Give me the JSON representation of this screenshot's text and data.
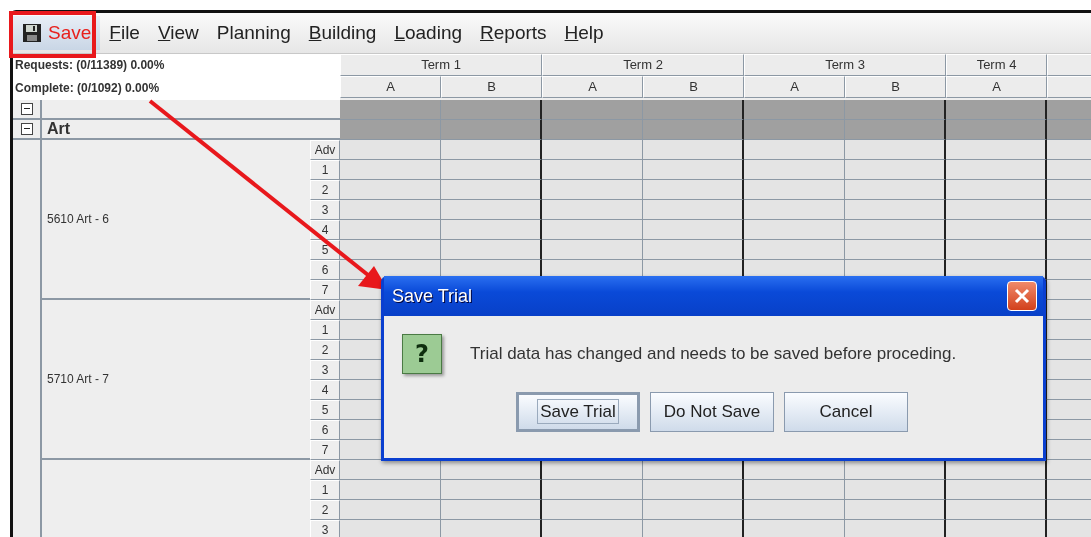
{
  "menu": {
    "items": [
      {
        "label": "Save",
        "kind": "save",
        "underlined": false
      },
      {
        "label": "File",
        "kind": "menu",
        "underlined": true
      },
      {
        "label": "View",
        "kind": "menu",
        "underlined": true
      },
      {
        "label": "Planning",
        "kind": "menu",
        "underlined": false
      },
      {
        "label": "Building",
        "kind": "menu",
        "underlined": true
      },
      {
        "label": "Loading",
        "kind": "menu",
        "underlined": true
      },
      {
        "label": "Reports",
        "kind": "menu",
        "underlined": true
      },
      {
        "label": "Help",
        "kind": "menu",
        "underlined": true
      }
    ]
  },
  "progress": [
    "Requests: (0/11389) 0.00%",
    "Complete: (0/1092) 0.00%"
  ],
  "terms": [
    {
      "label": "Term 1",
      "slots": [
        "A",
        "B"
      ]
    },
    {
      "label": "Term 2",
      "slots": [
        "A",
        "B"
      ]
    },
    {
      "label": "Term 3",
      "slots": [
        "A",
        "B"
      ]
    },
    {
      "label": "Term 4",
      "slots": [
        "A"
      ]
    }
  ],
  "groups": [
    {
      "expanded": true
    },
    {
      "label": "Art",
      "expanded": true
    }
  ],
  "courses": [
    {
      "name": "5610 Art - 6",
      "periods": [
        "Adv",
        "1",
        "2",
        "3",
        "4",
        "5",
        "6",
        "7"
      ]
    },
    {
      "name": "5710 Art - 7",
      "periods": [
        "Adv",
        "1",
        "2",
        "3",
        "4",
        "5",
        "6",
        "7"
      ]
    },
    {
      "periods": [
        "Adv",
        "1",
        "2",
        "3"
      ]
    }
  ],
  "dialog": {
    "title": "Save Trial",
    "icon": "?",
    "message": "Trial data has changed and needs to be saved before proceding.",
    "buttons": [
      {
        "label": "Save Trial",
        "focused": true
      },
      {
        "label": "Do Not Save",
        "focused": false
      },
      {
        "label": "Cancel",
        "focused": false
      }
    ]
  }
}
